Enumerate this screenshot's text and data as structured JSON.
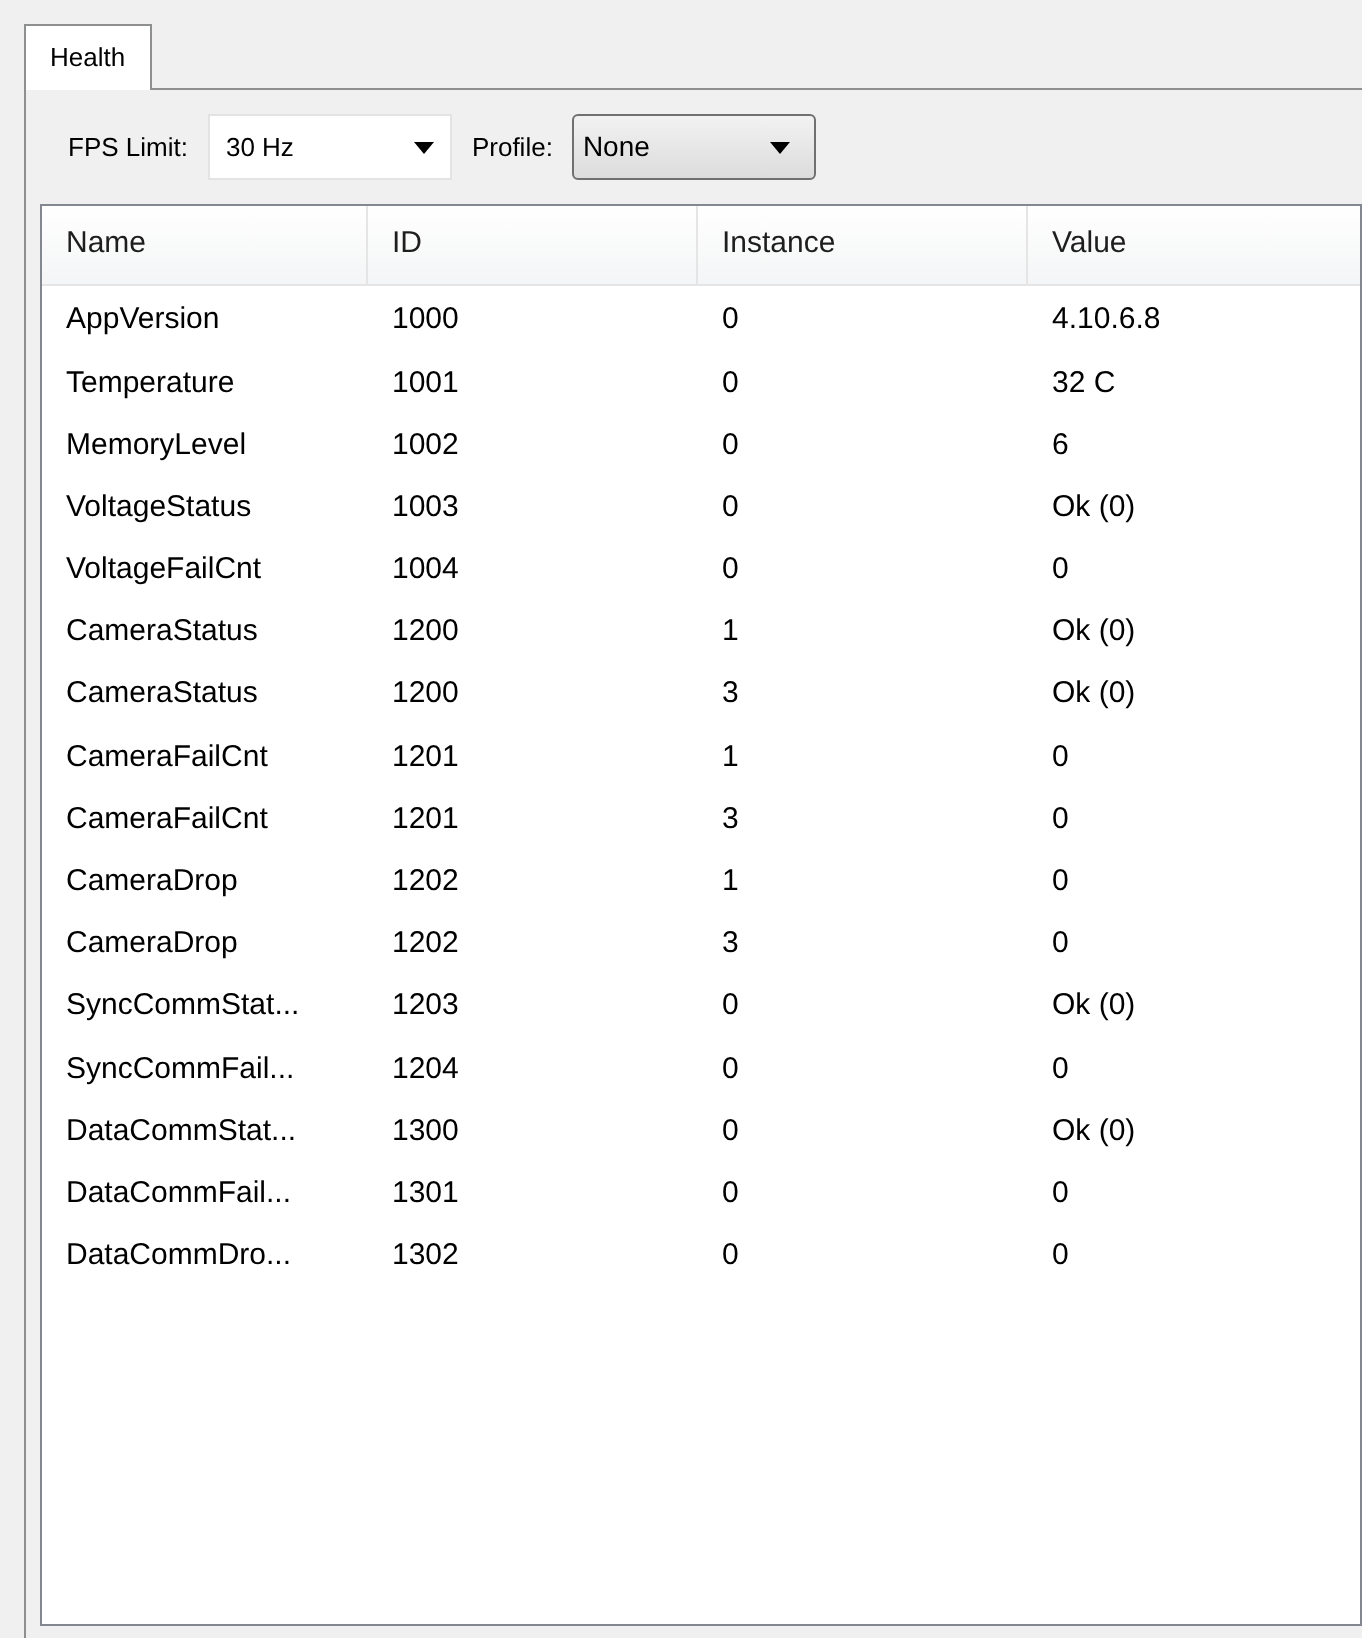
{
  "tabs": [
    {
      "label": "Health",
      "selected": true
    }
  ],
  "toolbar": {
    "fps_label": "FPS Limit:",
    "fps_value": "30 Hz",
    "profile_label": "Profile:",
    "profile_value": "None"
  },
  "table": {
    "columns": [
      "Name",
      "ID",
      "Instance",
      "Value"
    ],
    "rows": [
      [
        "AppVersion",
        "1000",
        "0",
        "4.10.6.8"
      ],
      [
        "Temperature",
        "1001",
        "0",
        "32 C"
      ],
      [
        "MemoryLevel",
        "1002",
        "0",
        "6"
      ],
      [
        "VoltageStatus",
        "1003",
        "0",
        "Ok (0)"
      ],
      [
        "VoltageFailCnt",
        "1004",
        "0",
        "0"
      ],
      [
        "CameraStatus",
        "1200",
        "1",
        "Ok (0)"
      ],
      [
        "CameraStatus",
        "1200",
        "3",
        "Ok (0)"
      ],
      [
        "CameraFailCnt",
        "1201",
        "1",
        "0"
      ],
      [
        "CameraFailCnt",
        "1201",
        "3",
        "0"
      ],
      [
        "CameraDrop",
        "1202",
        "1",
        "0"
      ],
      [
        "CameraDrop",
        "1202",
        "3",
        "0"
      ],
      [
        "SyncCommStat...",
        "1203",
        "0",
        "Ok (0)"
      ],
      [
        "SyncCommFail...",
        "1204",
        "0",
        "0"
      ],
      [
        "DataCommStat...",
        "1300",
        "0",
        "Ok (0)"
      ],
      [
        "DataCommFail...",
        "1301",
        "0",
        "0"
      ],
      [
        "DataCommDro...",
        "1302",
        "0",
        "0"
      ]
    ]
  }
}
